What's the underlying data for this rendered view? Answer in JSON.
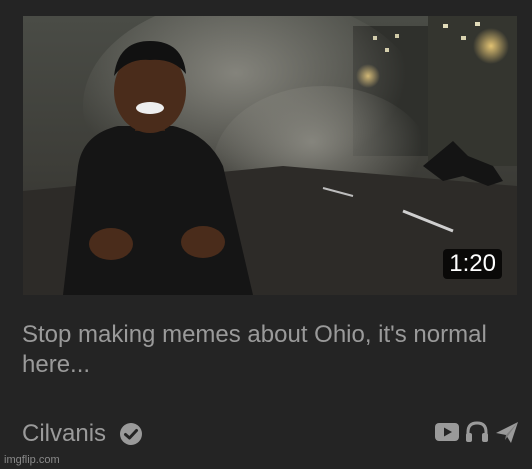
{
  "video": {
    "duration": "1:20",
    "title": "Stop making memes about Ohio, it's normal here...",
    "channel": "Cilvanis",
    "verified": true
  },
  "icons": {
    "verified": "check-badge-icon",
    "actions": [
      "video-icon",
      "headphones-icon",
      "send-icon"
    ]
  },
  "watermark": "imgflip.com",
  "colors": {
    "background": "#242424",
    "text": "#9a9a9a",
    "duration_bg": "#000000"
  }
}
